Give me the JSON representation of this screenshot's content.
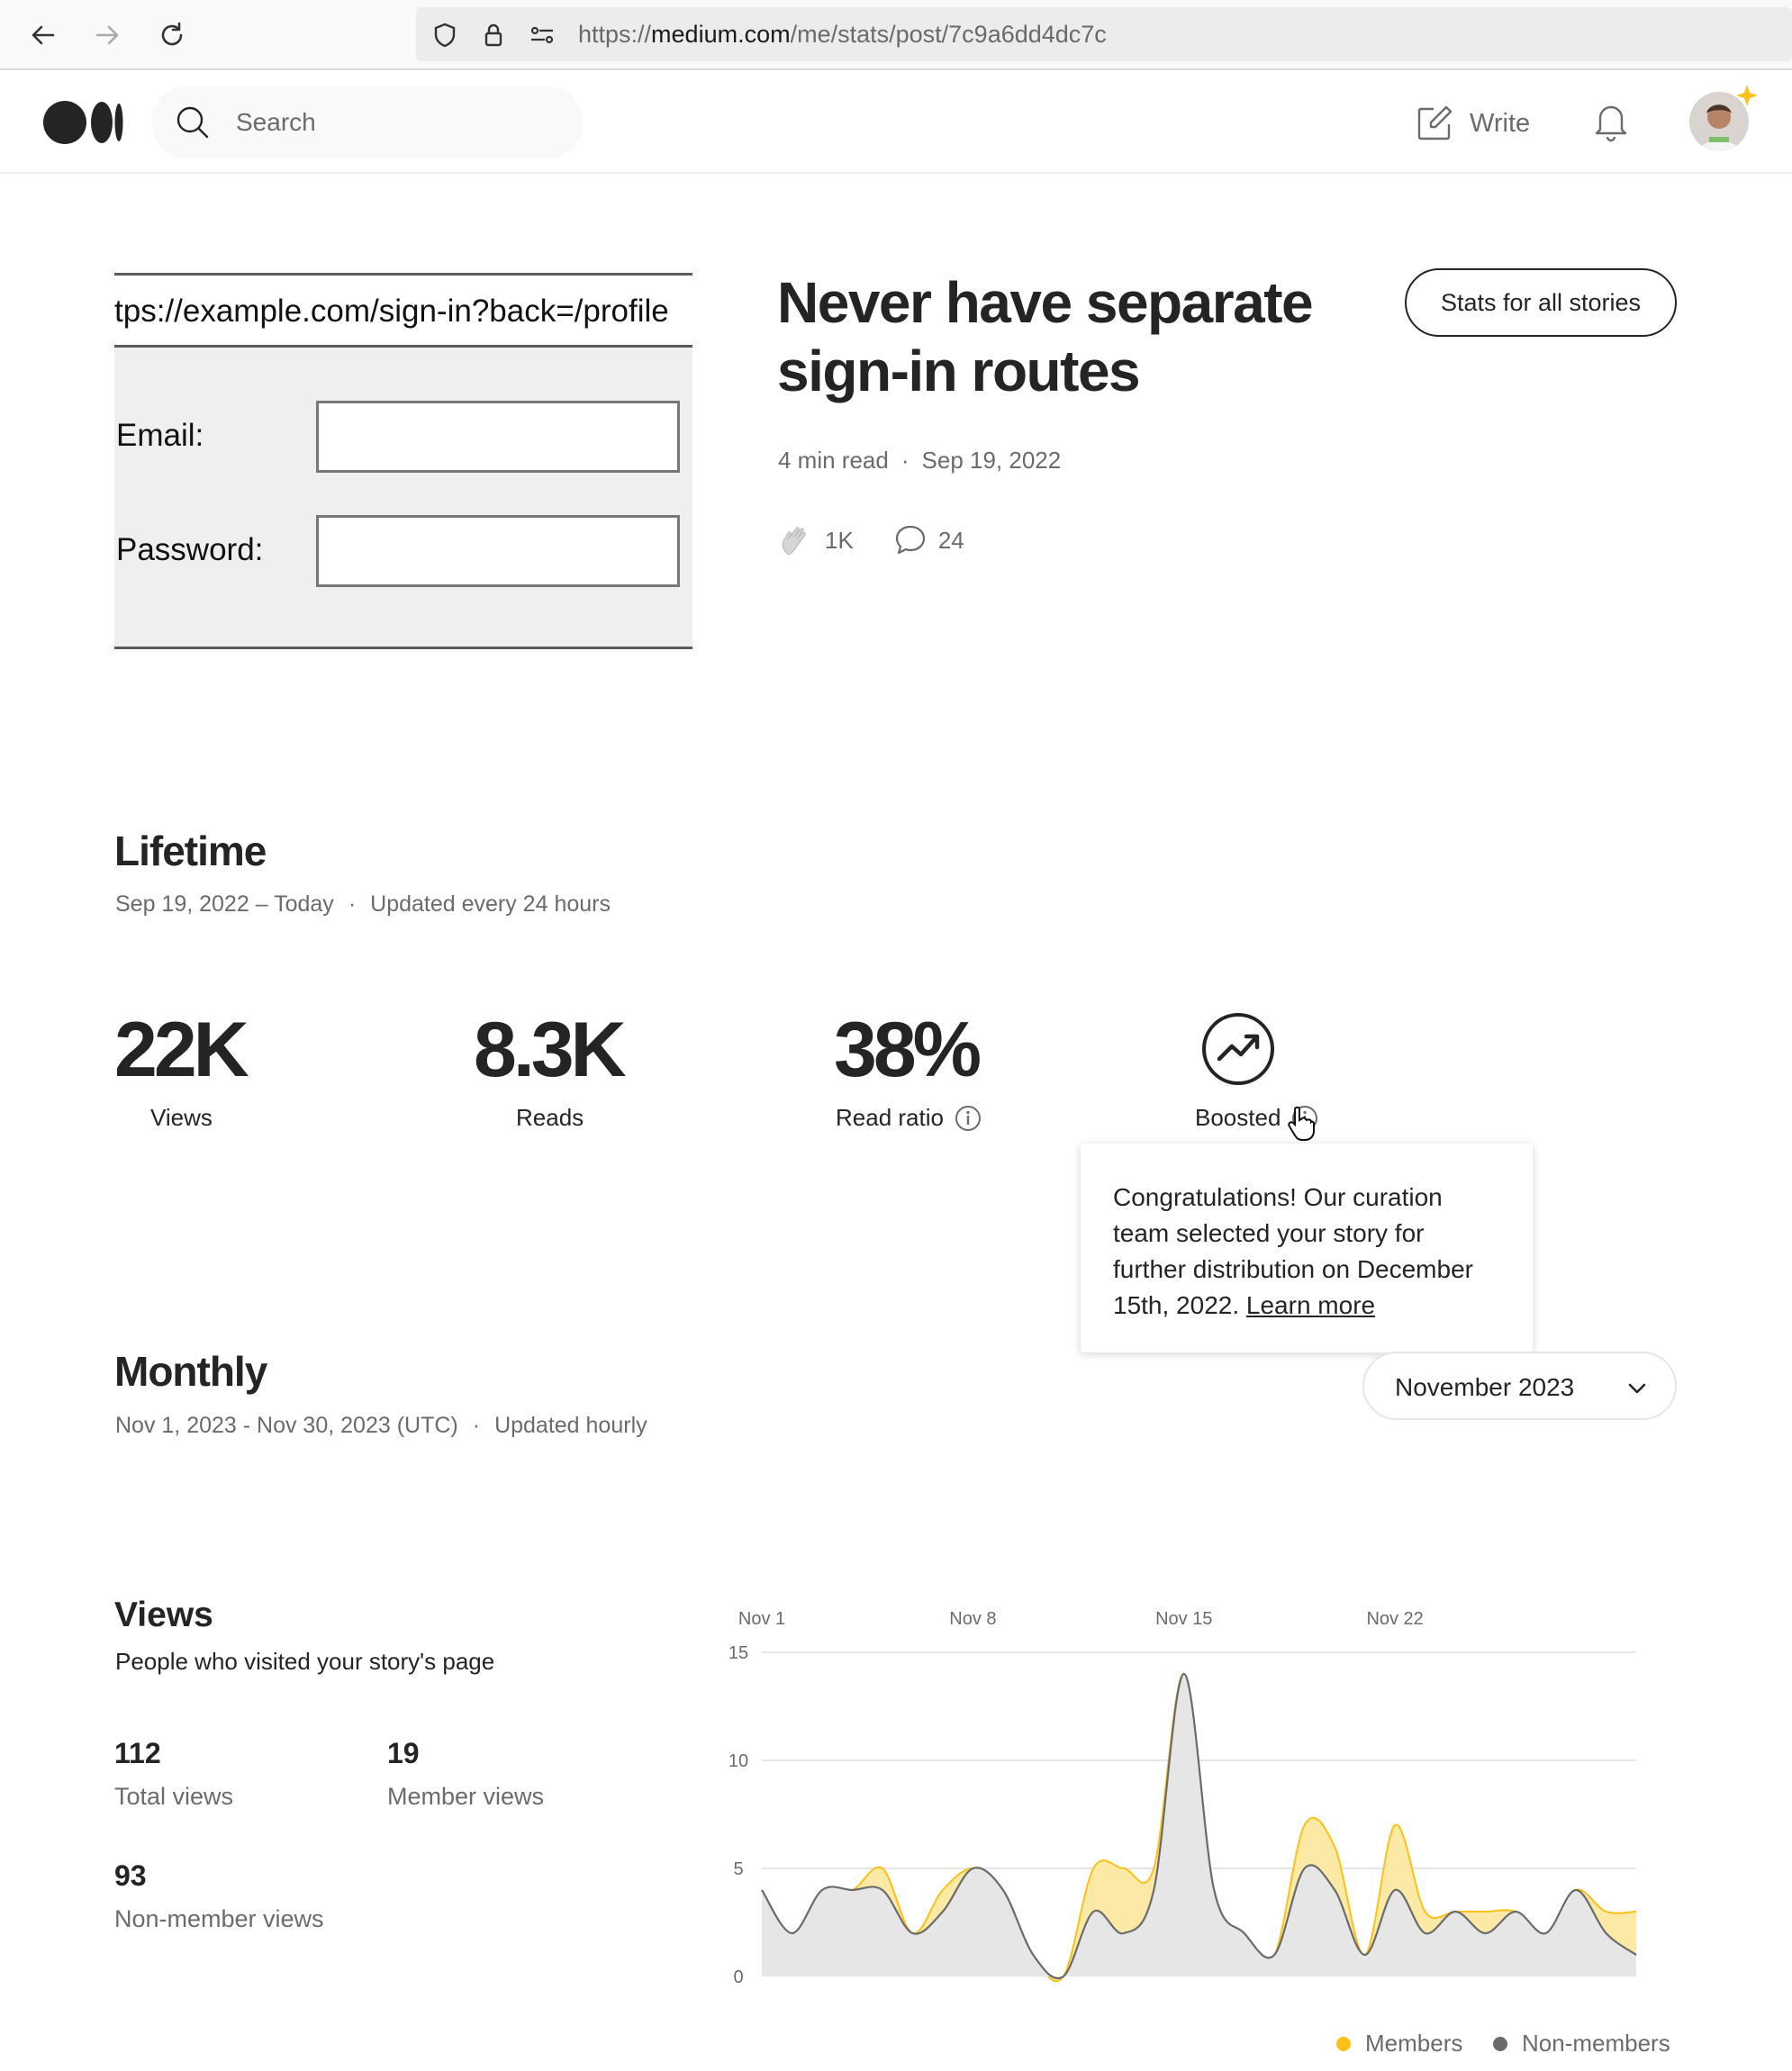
{
  "browser": {
    "url_scheme": "https://",
    "url_host": "medium.com",
    "url_path": "/me/stats/post/7c9a6dd4dc7c"
  },
  "header": {
    "search_placeholder": "Search",
    "write_label": "Write"
  },
  "story": {
    "thumbnail": {
      "url": "tps://example.com/sign-in?back=/profile",
      "email_label": "Email:",
      "password_label": "Password:"
    },
    "title": "Never have separate sign-in routes",
    "read_time": "4 min read",
    "date": "Sep 19, 2022",
    "claps": "1K",
    "responses": "24",
    "stats_all_button": "Stats for all stories"
  },
  "lifetime": {
    "title": "Lifetime",
    "range": "Sep 19, 2022 – Today",
    "update_note": "Updated every 24 hours",
    "metrics": [
      {
        "value": "22K",
        "label": "Views"
      },
      {
        "value": "8.3K",
        "label": "Reads"
      },
      {
        "value": "38%",
        "label": "Read ratio"
      }
    ],
    "boosted_label": "Boosted",
    "tooltip_text": "Congratulations! Our curation team selected your story for further distribution on December 15th, 2022.",
    "tooltip_link": "Learn more"
  },
  "monthly": {
    "title": "Monthly",
    "range": "Nov 1, 2023 - Nov 30, 2023 (UTC)",
    "update_note": "Updated hourly",
    "selected_month": "November 2023"
  },
  "views": {
    "title": "Views",
    "description": "People who visited your story's page",
    "total": "112",
    "total_label": "Total views",
    "member": "19",
    "member_label": "Member views",
    "nonmember": "93",
    "nonmember_label": "Non-member views"
  },
  "chart_data": {
    "type": "area",
    "x_tick_labels": [
      "Nov 1",
      "Nov 8",
      "Nov 15",
      "Nov 22"
    ],
    "x": [
      1,
      2,
      3,
      4,
      5,
      6,
      7,
      8,
      9,
      10,
      11,
      12,
      13,
      14,
      15,
      16,
      17,
      18,
      19,
      20,
      21,
      22,
      23,
      24,
      25,
      26,
      27,
      28,
      29,
      30
    ],
    "series": [
      {
        "name": "Non-members",
        "color": "#6b6b6b",
        "fill": "#e6e6e6",
        "values": [
          4,
          2,
          4,
          4,
          4,
          2,
          3,
          5,
          4,
          1,
          0,
          3,
          2,
          4,
          14,
          4,
          2,
          1,
          5,
          4,
          1,
          4,
          2,
          3,
          2,
          3,
          2,
          4,
          2,
          1
        ]
      },
      {
        "name": "Members",
        "color": "#ffc017",
        "fill": "#fbe9a5",
        "values": [
          0,
          0,
          0,
          0,
          1,
          0,
          1,
          0,
          0,
          0,
          0,
          2,
          3,
          1,
          0,
          0,
          0,
          0,
          2,
          2,
          0,
          3,
          1,
          0,
          1,
          0,
          0,
          0,
          1,
          2
        ]
      }
    ],
    "ylim": [
      0,
      15
    ],
    "yticks": [
      0,
      5,
      10,
      15
    ],
    "stacked": true,
    "grid": true,
    "legend": "bottom-right"
  }
}
